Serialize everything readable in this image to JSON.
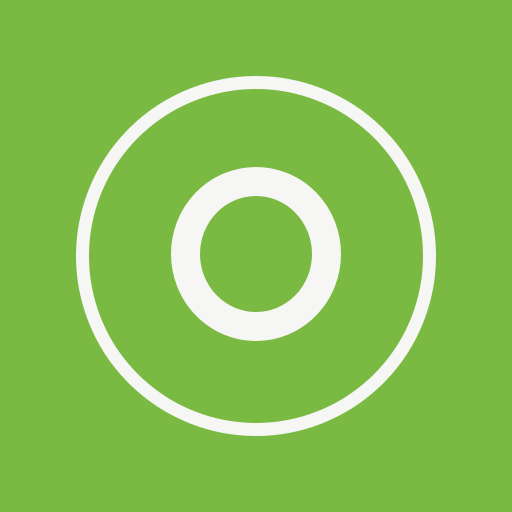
{
  "icon": {
    "name": "letter-o-app-icon",
    "glyph": "O",
    "background_color": "#7aba42",
    "foreground_color": "#f6f6f4"
  }
}
